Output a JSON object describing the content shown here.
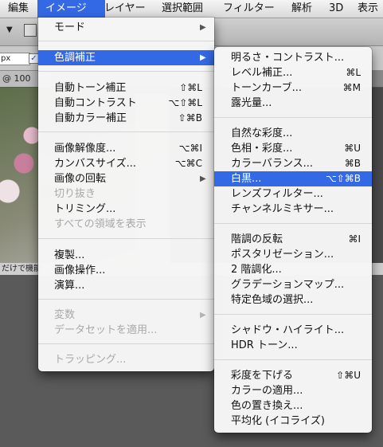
{
  "menubar": {
    "items": [
      "編集",
      "イメージ",
      "レイヤー",
      "選択範囲",
      "フィルター",
      "解析",
      "3D",
      "表示"
    ],
    "active_index": 1
  },
  "background": {
    "field_text": "px",
    "doc_tab": "@ 100",
    "status_text": "だけで機能"
  },
  "image_menu": {
    "items": [
      {
        "label": "モード",
        "submenu": true
      },
      {
        "label": "色調補正",
        "submenu": true,
        "highlighted": true
      },
      {
        "label": "自動トーン補正",
        "shortcut": "⇧⌘L"
      },
      {
        "label": "自動コントラスト",
        "shortcut": "⌥⇧⌘L"
      },
      {
        "label": "自動カラー補正",
        "shortcut": "⇧⌘B"
      },
      {
        "label": "画像解像度...",
        "shortcut": "⌥⌘I"
      },
      {
        "label": "カンバスサイズ...",
        "shortcut": "⌥⌘C"
      },
      {
        "label": "画像の回転",
        "submenu": true
      },
      {
        "label": "切り抜き",
        "disabled": true
      },
      {
        "label": "トリミング..."
      },
      {
        "label": "すべての領域を表示",
        "disabled": true
      },
      {
        "label": "複製..."
      },
      {
        "label": "画像操作..."
      },
      {
        "label": "演算..."
      },
      {
        "label": "変数",
        "submenu": true,
        "disabled": true
      },
      {
        "label": "データセットを適用...",
        "disabled": true
      },
      {
        "label": "トラッピング...",
        "disabled": true
      }
    ]
  },
  "adjust_menu": {
    "items": [
      {
        "label": "明るさ・コントラスト..."
      },
      {
        "label": "レベル補正...",
        "shortcut": "⌘L"
      },
      {
        "label": "トーンカーブ...",
        "shortcut": "⌘M"
      },
      {
        "label": "露光量..."
      },
      {
        "label": "自然な彩度..."
      },
      {
        "label": "色相・彩度...",
        "shortcut": "⌘U"
      },
      {
        "label": "カラーバランス...",
        "shortcut": "⌘B"
      },
      {
        "label": "白黒...",
        "shortcut": "⌥⇧⌘B",
        "highlighted": true
      },
      {
        "label": "レンズフィルター..."
      },
      {
        "label": "チャンネルミキサー..."
      },
      {
        "label": "階調の反転",
        "shortcut": "⌘I"
      },
      {
        "label": "ポスタリゼーション..."
      },
      {
        "label": "2 階調化..."
      },
      {
        "label": "グラデーションマップ..."
      },
      {
        "label": "特定色域の選択..."
      },
      {
        "label": "シャドウ・ハイライト..."
      },
      {
        "label": "HDR トーン..."
      },
      {
        "label": "彩度を下げる",
        "shortcut": "⇧⌘U"
      },
      {
        "label": "カラーの適用..."
      },
      {
        "label": "色の置き換え..."
      },
      {
        "label": "平均化 (イコライズ)"
      }
    ]
  }
}
